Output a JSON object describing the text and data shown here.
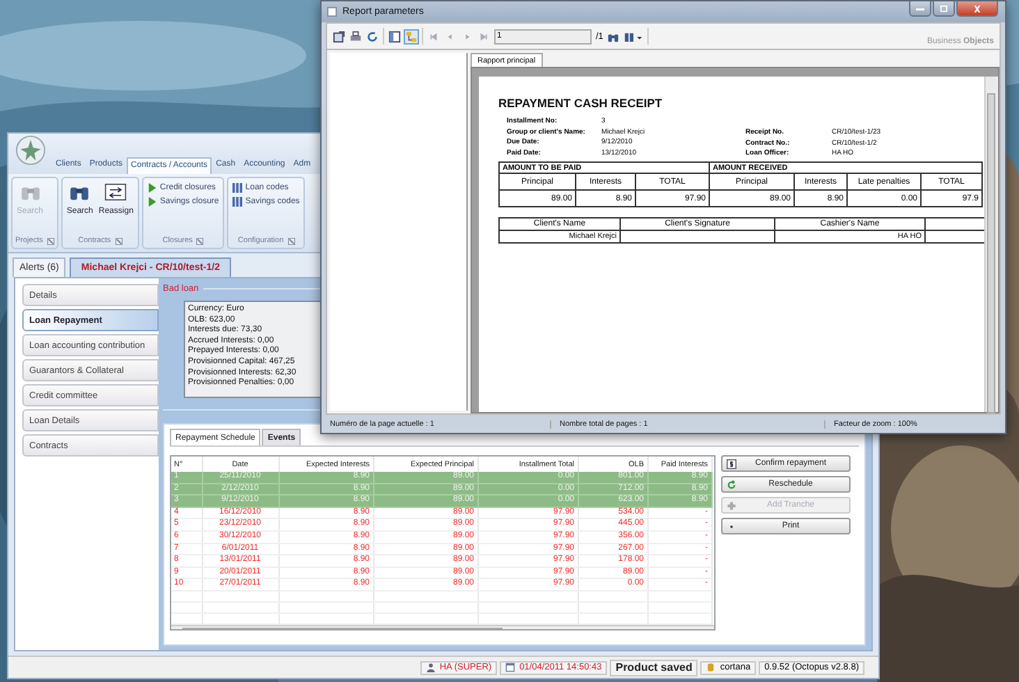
{
  "main_window": {
    "menu_tabs": [
      {
        "label": "Clients",
        "selected": false
      },
      {
        "label": "Products",
        "selected": false
      },
      {
        "label": "Contracts / Accounts",
        "selected": true
      },
      {
        "label": "Cash",
        "selected": false
      },
      {
        "label": "Accounting",
        "selected": false
      },
      {
        "label": "Adm",
        "selected": false
      }
    ],
    "ribbon_groups": [
      {
        "title": "Projects",
        "items": [
          {
            "label": "Search",
            "kind": "binoculars",
            "disabled": true
          }
        ]
      },
      {
        "title": "Contracts",
        "items": [
          {
            "label": "Search",
            "kind": "binoculars",
            "disabled": false
          },
          {
            "label": "Reassign",
            "kind": "swap",
            "disabled": false
          }
        ]
      },
      {
        "title": "Closures",
        "items": [
          {
            "label": "Credit closures",
            "kind": "play",
            "disabled": false
          },
          {
            "label": "Savings closure",
            "kind": "play",
            "disabled": false
          }
        ]
      },
      {
        "title": "Configuration",
        "items": [
          {
            "label": "Loan codes",
            "kind": "codes",
            "disabled": false
          },
          {
            "label": "Savings codes",
            "kind": "codes",
            "disabled": false
          }
        ]
      }
    ],
    "doc_tabs": [
      {
        "label": "Alerts (6)",
        "selected": false
      },
      {
        "label": "Michael Krejci - CR/10/test-1/2",
        "selected": true
      }
    ],
    "nav": [
      {
        "label": "Details",
        "selected": false
      },
      {
        "label": "Loan Repayment",
        "selected": true
      },
      {
        "label": "Loan accounting contribution",
        "selected": false
      },
      {
        "label": "Guarantors & Collateral",
        "selected": false
      },
      {
        "label": "Credit committee",
        "selected": false
      },
      {
        "label": "Loan Details",
        "selected": false
      },
      {
        "label": "Contracts",
        "selected": false
      }
    ],
    "group_label": "Bad loan",
    "info_lines": [
      "Currency:  Euro",
      "OLB: 623,00",
      "Interests due: 73,30",
      "Accrued Interests: 0,00",
      "Prepayed Interests: 0,00",
      "Provisionned Capital: 467,25",
      "Provisionned Interests: 62,30",
      "Provisionned Penalties: 0,00"
    ],
    "schedule_tabs": [
      {
        "label": "Repayment Schedule",
        "selected": true
      },
      {
        "label": "Events",
        "selected": false
      }
    ],
    "grid": {
      "columns": [
        "N°",
        "Date",
        "Expected Interests",
        "Expected Principal",
        "Installment Total",
        "OLB",
        "Paid Interests"
      ],
      "rows": [
        {
          "paid": true,
          "cells": [
            "1",
            "25/11/2010",
            "8.90",
            "89.00",
            "0.00",
            "801.00",
            "8.90"
          ]
        },
        {
          "paid": true,
          "cells": [
            "2",
            "2/12/2010",
            "8.90",
            "89.00",
            "0.00",
            "712.00",
            "8.90"
          ]
        },
        {
          "paid": true,
          "cells": [
            "3",
            "9/12/2010",
            "8.90",
            "89.00",
            "0.00",
            "623.00",
            "8.90"
          ]
        },
        {
          "paid": false,
          "cells": [
            "4",
            "16/12/2010",
            "8.90",
            "89.00",
            "97.90",
            "534.00",
            "-"
          ]
        },
        {
          "paid": false,
          "cells": [
            "5",
            "23/12/2010",
            "8.90",
            "89.00",
            "97.90",
            "445.00",
            "-"
          ]
        },
        {
          "paid": false,
          "cells": [
            "6",
            "30/12/2010",
            "8.90",
            "89.00",
            "97.90",
            "356.00",
            "-"
          ]
        },
        {
          "paid": false,
          "cells": [
            "7",
            "6/01/2011",
            "8.90",
            "89.00",
            "97.90",
            "267.00",
            "-"
          ]
        },
        {
          "paid": false,
          "cells": [
            "8",
            "13/01/2011",
            "8.90",
            "89.00",
            "97.90",
            "178.00",
            "-"
          ]
        },
        {
          "paid": false,
          "cells": [
            "9",
            "20/01/2011",
            "8.90",
            "89.00",
            "97.90",
            "89.00",
            "-"
          ]
        },
        {
          "paid": false,
          "cells": [
            "10",
            "27/01/2011",
            "8.90",
            "89.00",
            "97.90",
            "0.00",
            "-"
          ]
        }
      ]
    },
    "actions": [
      {
        "label": "Confirm repayment",
        "kind": "dollar",
        "disabled": false
      },
      {
        "label": "Reschedule",
        "kind": "refresh",
        "disabled": false
      },
      {
        "label": "Add Tranche",
        "kind": "plus",
        "disabled": true
      },
      {
        "label": "Print",
        "kind": "dot",
        "disabled": false
      }
    ],
    "status_bar": {
      "user": "HA (SUPER)",
      "datetime": "01/04/2011 14:50:43",
      "message": "Product saved",
      "database": "cortana",
      "version": "0.9.52 (Octopus v2.8.8)"
    }
  },
  "report_window": {
    "title": "Report parameters",
    "page_field": "1",
    "page_total": "/1",
    "logo": "Business **Objects**",
    "tab": "Rapport principal",
    "receipt": {
      "title": "REPAYMENT CASH RECEIPT",
      "left_fields": [
        {
          "label": "Installment No:",
          "value": "3"
        },
        {
          "label": "Group or client's Name:",
          "value": "Michael Krejci"
        },
        {
          "label": "Due Date:",
          "value": "9/12/2010"
        },
        {
          "label": "Paid Date:",
          "value": "13/12/2010"
        }
      ],
      "right_fields": [
        {
          "label": "Receipt No.",
          "value": "CR/10/test-1/23"
        },
        {
          "label": "Contract No.:",
          "value": "CR/10/test-1/2"
        },
        {
          "label": "Loan Officer:",
          "value": "HA HO"
        }
      ],
      "amount_groups": [
        "AMOUNT TO BE PAID",
        "AMOUNT RECEIVED"
      ],
      "amount_headers": [
        "Principal",
        "Interests",
        "TOTAL",
        "Principal",
        "Interests",
        "Late penalties",
        "TOTAL"
      ],
      "amount_values": [
        "89.00",
        "8.90",
        "97.90",
        "89.00",
        "8.90",
        "0.00",
        "97.9"
      ],
      "sign_headers": [
        "Client's Name",
        "Client's Signature",
        "Cashier's Name"
      ],
      "client_name": "Michael Krejci",
      "cashier_name": "HA HO"
    },
    "status": [
      "Numéro de la page actuelle : 1",
      "Nombre total de pages : 1",
      "Facteur de zoom : 100%"
    ]
  }
}
